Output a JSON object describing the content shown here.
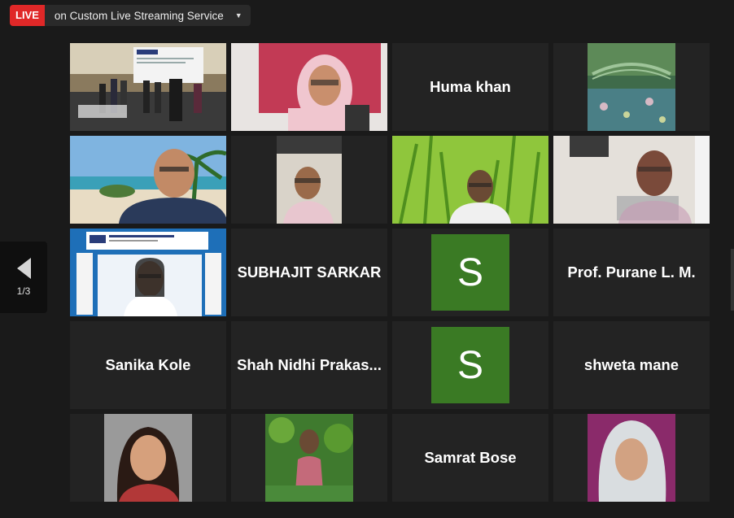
{
  "header": {
    "live_label": "LIVE",
    "stream_title": "on Custom Live Streaming Service"
  },
  "pager": {
    "page_indicator": "1/3"
  },
  "poster": {
    "title": "5th World Conference on Pharmaceutical Science and Drug Manufacturing",
    "org_logo": "APR"
  },
  "participants": [
    "Huma khan",
    "SUBHAJIT SARKAR",
    "S",
    "Prof. Purane L. M.",
    "Sanika Kole",
    "Shah Nidhi Prakas...",
    "S",
    "shweta mane",
    "Samrat Bose"
  ],
  "colors": {
    "live": "#e02828",
    "active_speaker_border": "#bfe06a",
    "avatar_green": "#3a7a24"
  },
  "icons": {
    "prev": "chevron-left-icon",
    "dropdown": "caret-down-icon"
  }
}
